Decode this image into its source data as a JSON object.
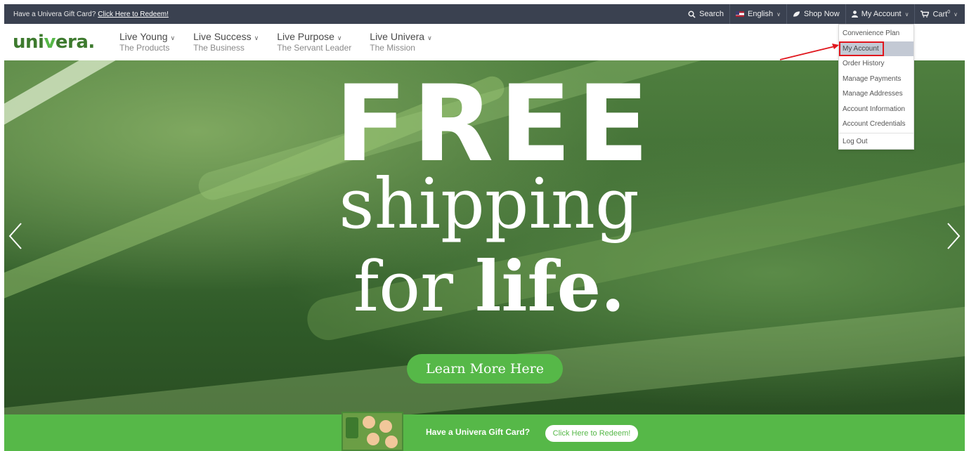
{
  "topbar": {
    "promo_text": "Have a Univera Gift Card?",
    "promo_link": "Click Here to Redeem!",
    "search_label": "Search",
    "language_label": "English",
    "shop_label": "Shop Now",
    "account_label": "My Account",
    "cart_label": "Cart",
    "cart_count": "0"
  },
  "brand": {
    "logo_text": "uni",
    "logo_leaf": "v",
    "logo_text2": "era."
  },
  "nav": {
    "items": [
      {
        "title": "Live Young",
        "subtitle": "The Products"
      },
      {
        "title": "Live Success",
        "subtitle": "The Business"
      },
      {
        "title": "Live Purpose",
        "subtitle": "The Servant Leader"
      },
      {
        "title": "Live Univera",
        "subtitle": "The Mission"
      }
    ]
  },
  "hero": {
    "line1": "FREE",
    "line2": "shipping",
    "line3_prefix": "for ",
    "line3_bold": "life",
    "line3_suffix": ".",
    "cta": "Learn More Here"
  },
  "giftbar": {
    "text": "Have a Univera Gift Card?",
    "button": "Click Here to Redeem!"
  },
  "account_menu": {
    "items": [
      "Convenience Plan",
      "My Account",
      "Order History",
      "Manage Payments",
      "Manage Addresses",
      "Account Information",
      "Account Credentials",
      "Log Out"
    ],
    "highlighted": "My Account"
  },
  "colors": {
    "topbar_bg": "#3a4150",
    "brand_green": "#56b848",
    "highlight_red": "#e0171e"
  }
}
